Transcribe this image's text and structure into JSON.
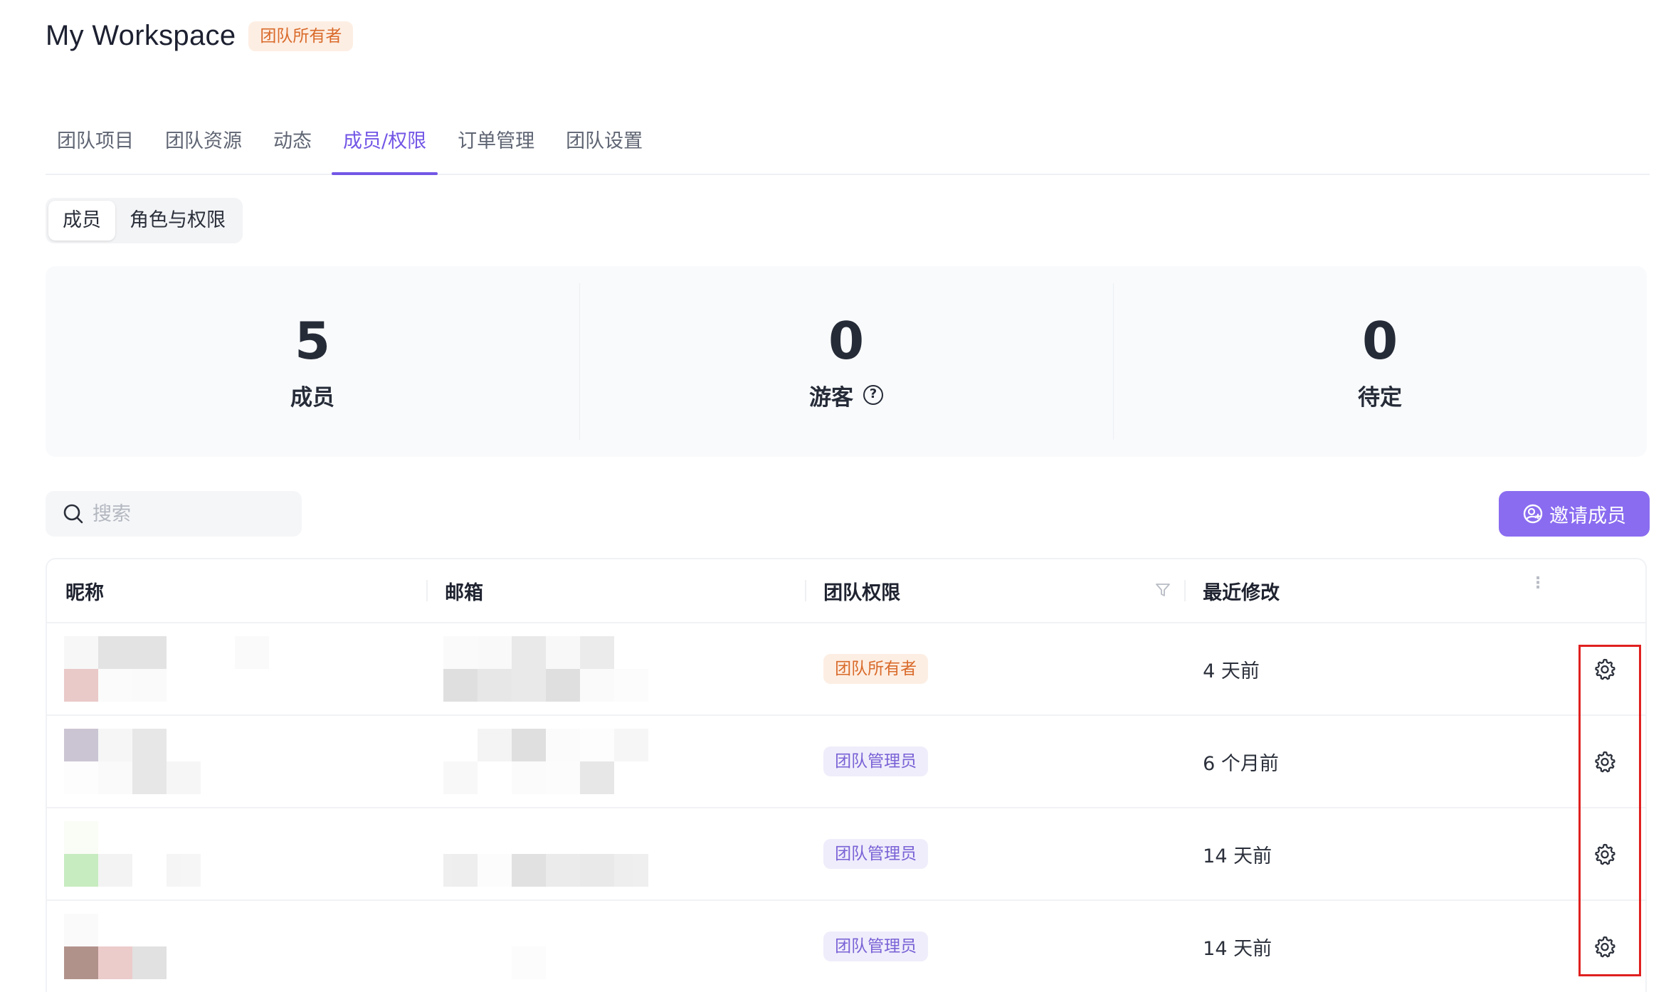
{
  "header": {
    "title": "My Workspace",
    "role_badge": "团队所有者"
  },
  "tabs": [
    {
      "label": "团队项目"
    },
    {
      "label": "团队资源"
    },
    {
      "label": "动态"
    },
    {
      "label": "成员/权限",
      "active": true
    },
    {
      "label": "订单管理"
    },
    {
      "label": "团队设置"
    }
  ],
  "segmented": {
    "members": "成员",
    "roles": "角色与权限",
    "selected": "成员"
  },
  "stats": {
    "members": {
      "value": "5",
      "label": "成员"
    },
    "guests": {
      "value": "0",
      "label": "游客",
      "icon": "question-circle-icon"
    },
    "pending": {
      "value": "0",
      "label": "待定"
    }
  },
  "search": {
    "placeholder": "搜索",
    "value": ""
  },
  "invite_button": {
    "label": "邀请成员",
    "icon": "user-add-icon"
  },
  "table": {
    "columns": [
      "昵称",
      "邮箱",
      "团队权限",
      "最近修改"
    ],
    "rows": [
      {
        "nickname": "",
        "email": "",
        "role": "团队所有者",
        "role_type": "owner",
        "modified": "4 天前"
      },
      {
        "nickname": "",
        "email": "",
        "role": "团队管理员",
        "role_type": "admin",
        "modified": "6 个月前"
      },
      {
        "nickname": "",
        "email": "",
        "role": "团队管理员",
        "role_type": "admin",
        "modified": "14 天前"
      },
      {
        "nickname": "",
        "email": "",
        "role": "团队管理员",
        "role_type": "admin",
        "modified": "14 天前"
      }
    ]
  },
  "colors": {
    "accent": "#7356e6",
    "invite_bg": "#8a6cf0",
    "owner_badge_bg": "#fdeee3",
    "owner_badge_text": "#d96a2a",
    "admin_badge_bg": "#efedfb",
    "admin_badge_text": "#7a62d6",
    "highlight_box": "#e02020"
  }
}
